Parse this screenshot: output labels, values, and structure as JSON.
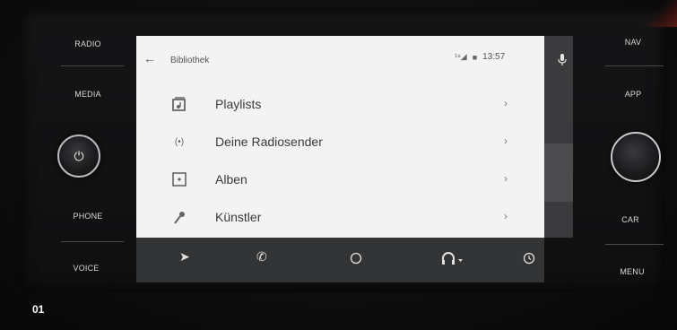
{
  "hardware": {
    "left_buttons": [
      "RADIO",
      "MEDIA",
      "PHONE",
      "VOICE"
    ],
    "right_buttons": [
      "NAV",
      "APP",
      "CAR",
      "MENU"
    ]
  },
  "header": {
    "title": "Bibliothek",
    "status_signal": "¹⁸◢",
    "status_lock": "■",
    "time": "13:57"
  },
  "library": {
    "items": [
      {
        "label": "Playlists",
        "icon": "playlist-icon"
      },
      {
        "label": "Deine Radiosender",
        "icon": "radio-icon"
      },
      {
        "label": "Alben",
        "icon": "album-icon"
      },
      {
        "label": "Künstler",
        "icon": "artist-icon"
      }
    ]
  },
  "navbar": {
    "icons": [
      "navigation-icon",
      "phone-icon",
      "home-icon",
      "headphones-icon",
      "recent-icon"
    ]
  },
  "figure_label": "01",
  "colors": {
    "screen_bg": "#f3f3f3",
    "navbar_bg": "#333436",
    "bezel": "#151517"
  }
}
